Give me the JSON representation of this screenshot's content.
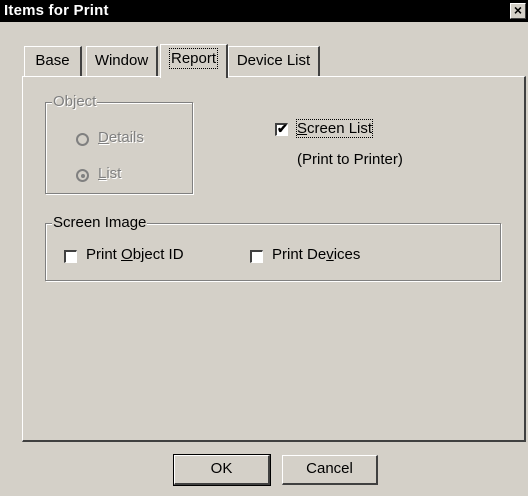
{
  "window": {
    "title": "Items for Print",
    "close_glyph": "×"
  },
  "tabs": [
    {
      "label": "Base",
      "active": false
    },
    {
      "label": "Window",
      "active": false
    },
    {
      "label": "Report",
      "active": true
    },
    {
      "label": "Device List",
      "active": false
    }
  ],
  "object_group": {
    "title": "Object",
    "details_label": "Details",
    "list_label": "List",
    "selected": "List",
    "enabled": false
  },
  "screen_list": {
    "label": "Screen List",
    "checked": true,
    "note": "(Print to Printer)"
  },
  "screen_image_group": {
    "title": "Screen Image",
    "print_object_id_label": "Print Object ID",
    "print_object_id_checked": false,
    "print_devices_label": "Print Devices",
    "print_devices_checked": false
  },
  "buttons": {
    "ok_label": "OK",
    "cancel_label": "Cancel"
  }
}
